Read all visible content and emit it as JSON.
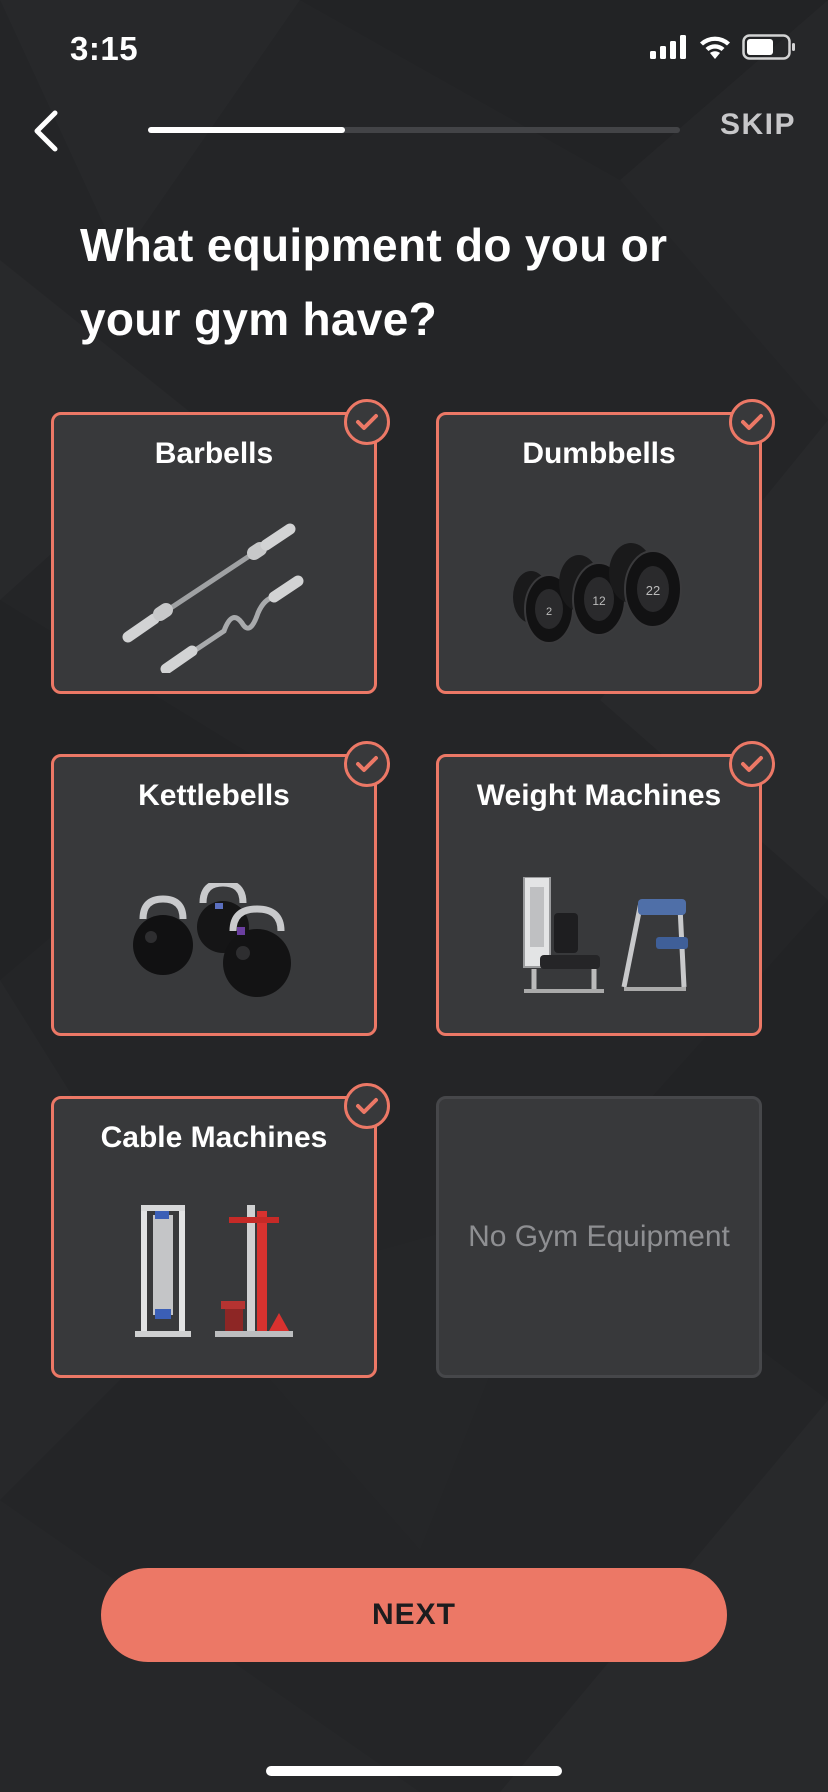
{
  "status": {
    "time": "3:15"
  },
  "nav": {
    "skip_label": "SKIP",
    "progress": 0.37
  },
  "question": "What equipment do you or your gym have?",
  "options": [
    {
      "label": "Barbells",
      "selected": true,
      "icon": "barbell-icon"
    },
    {
      "label": "Dumbbells",
      "selected": true,
      "icon": "dumbbell-icon",
      "plate_labels": [
        "2",
        "12",
        "22"
      ]
    },
    {
      "label": "Kettlebells",
      "selected": true,
      "icon": "kettlebell-icon"
    },
    {
      "label": "Weight Machines",
      "selected": true,
      "icon": "weight-machine-icon"
    },
    {
      "label": "Cable Machines",
      "selected": true,
      "icon": "cable-machine-icon"
    },
    {
      "label": "No Gym Equipment",
      "selected": false
    }
  ],
  "next_label": "NEXT",
  "colors": {
    "accent": "#ec7866",
    "background": "#242527",
    "card": "#38393b"
  }
}
